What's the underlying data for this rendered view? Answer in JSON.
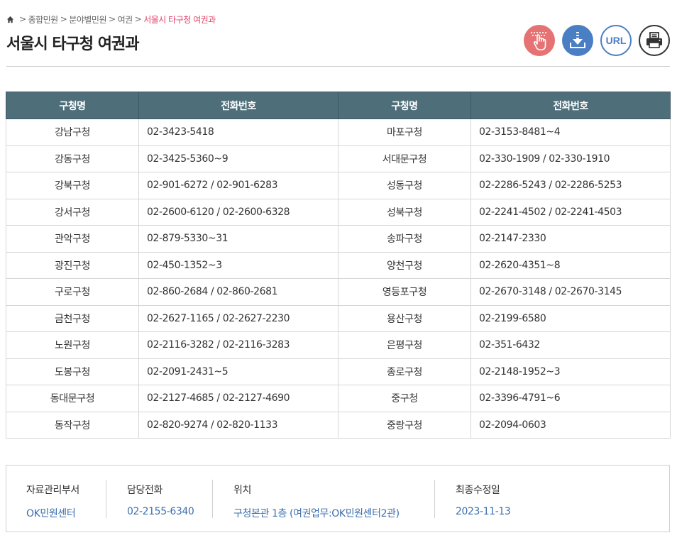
{
  "breadcrumb": {
    "items": [
      "종합민원",
      "분야별민원",
      "여권"
    ],
    "current": "서울시 타구청 여권과",
    "separator": ">"
  },
  "page_title": "서울시 타구청 여권과",
  "tools": {
    "hand_icon": "touch-hand-icon",
    "download_icon": "download-icon",
    "url_label": "URL",
    "print_icon": "printer-icon"
  },
  "table": {
    "headers": [
      "구청명",
      "전화번호",
      "구청명",
      "전화번호"
    ],
    "rows": [
      [
        "강남구청",
        "02-3423-5418",
        "마포구청",
        "02-3153-8481~4"
      ],
      [
        "강동구청",
        "02-3425-5360~9",
        "서대문구청",
        "02-330-1909 / 02-330-1910"
      ],
      [
        "강북구청",
        "02-901-6272 / 02-901-6283",
        "성동구청",
        "02-2286-5243 / 02-2286-5253"
      ],
      [
        "강서구청",
        "02-2600-6120 / 02-2600-6328",
        "성북구청",
        "02-2241-4502 / 02-2241-4503"
      ],
      [
        "관악구청",
        "02-879-5330~31",
        "송파구청",
        "02-2147-2330"
      ],
      [
        "광진구청",
        "02-450-1352~3",
        "양천구청",
        "02-2620-4351~8"
      ],
      [
        "구로구청",
        "02-860-2684 / 02-860-2681",
        "영등포구청",
        "02-2670-3148 / 02-2670-3145"
      ],
      [
        "금천구청",
        "02-2627-1165 / 02-2627-2230",
        "용산구청",
        "02-2199-6580"
      ],
      [
        "노원구청",
        "02-2116-3282 / 02-2116-3283",
        "은평구청",
        "02-351-6432"
      ],
      [
        "도봉구청",
        "02-2091-2431~5",
        "종로구청",
        "02-2148-1952~3"
      ],
      [
        "동대문구청",
        "02-2127-4685 / 02-2127-4690",
        "중구청",
        "02-3396-4791~6"
      ],
      [
        "동작구청",
        "02-820-9274 / 02-820-1133",
        "중랑구청",
        "02-2094-0603"
      ]
    ]
  },
  "info": {
    "dept_label": "자료관리부서",
    "dept_value": "OK민원센터",
    "phone_label": "담당전화",
    "phone_value": "02-2155-6340",
    "location_label": "위치",
    "location_value": "구청본관 1층 (여권업무:OK민원센터2관)",
    "updated_label": "최종수정일",
    "updated_value": "2023-11-13"
  },
  "colors": {
    "header_bg": "#4e6e7a",
    "accent_link": "#3b6fae",
    "breadcrumb_current": "#e0436a",
    "hand_button": "#e67373",
    "download_button": "#4a7fc4"
  }
}
